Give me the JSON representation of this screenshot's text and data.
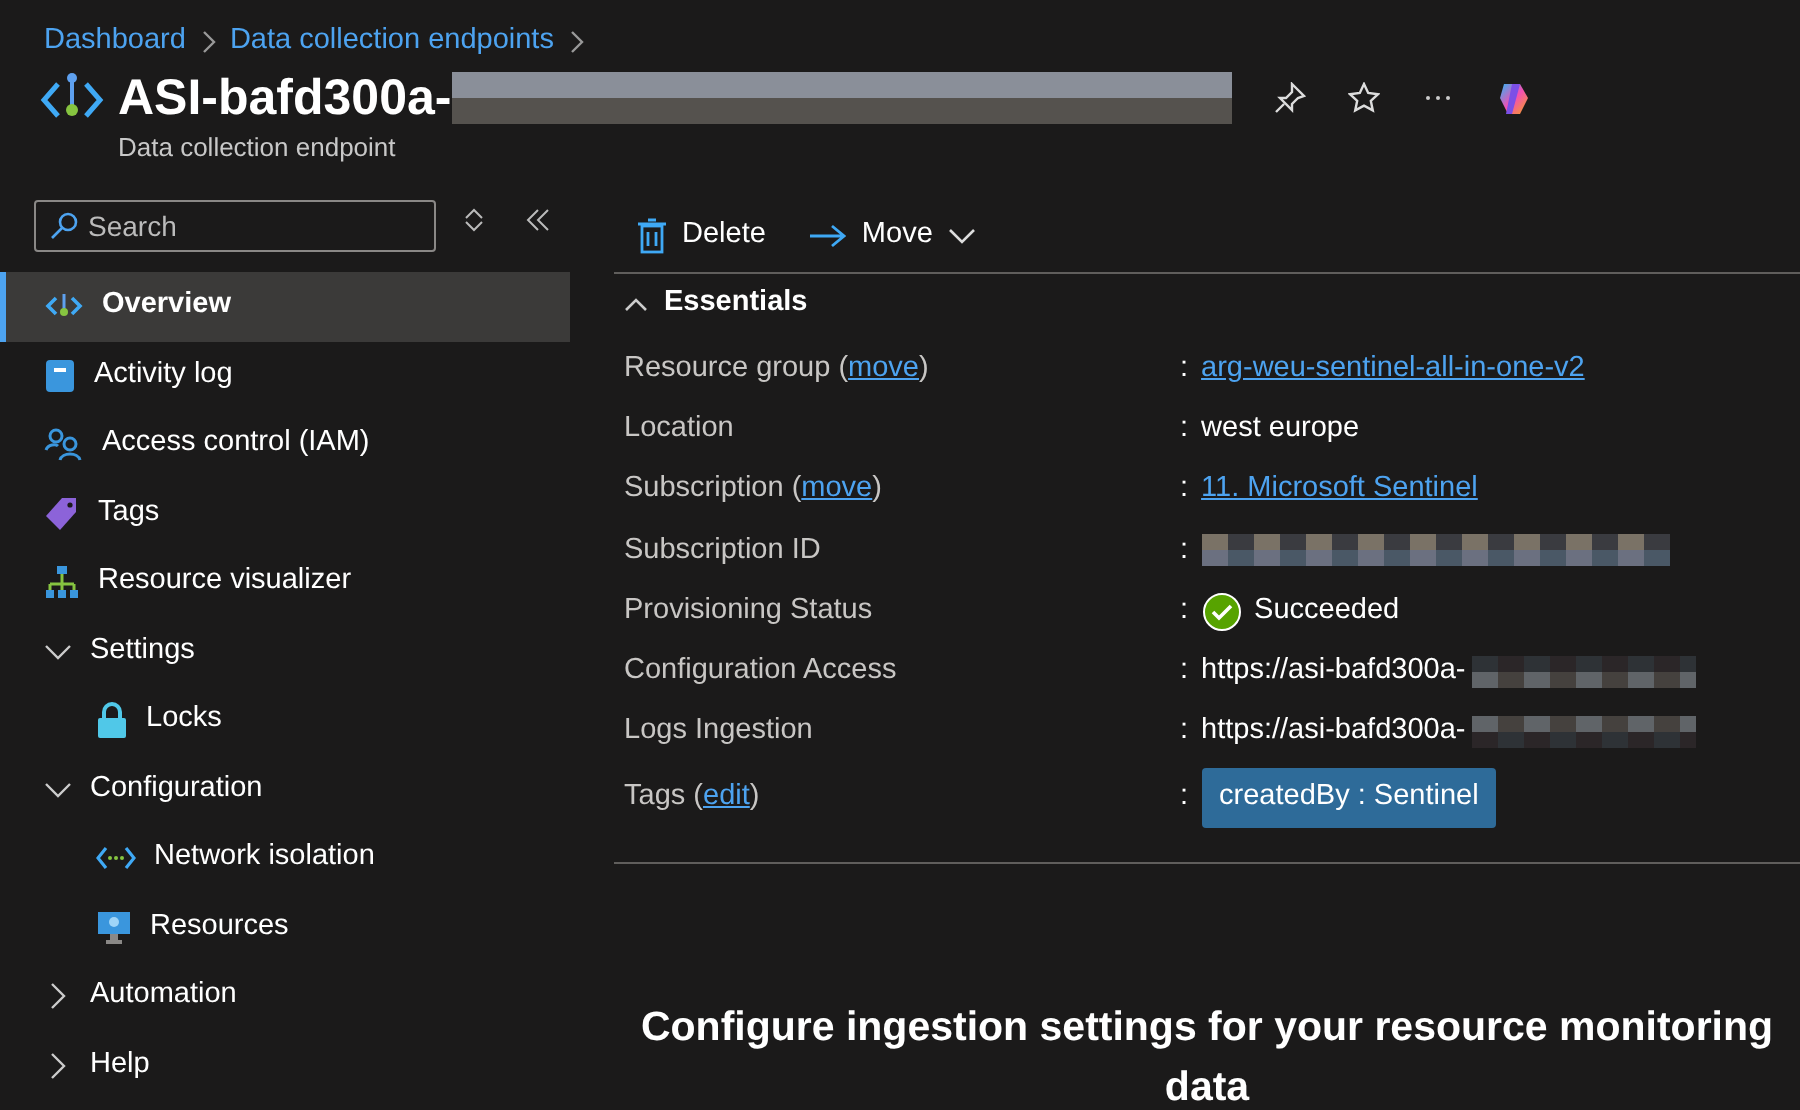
{
  "breadcrumb": [
    "Dashboard",
    "Data collection endpoints"
  ],
  "header": {
    "title": "ASI-bafd300a-",
    "subtitle": "Data collection endpoint"
  },
  "search": {
    "placeholder": "Search"
  },
  "sidebar": {
    "items": [
      {
        "kind": "item",
        "label": "Overview",
        "selected": true
      },
      {
        "kind": "item",
        "label": "Activity log",
        "selected": false
      },
      {
        "kind": "item",
        "label": "Access control (IAM)",
        "selected": false
      },
      {
        "kind": "item",
        "label": "Tags",
        "selected": false
      },
      {
        "kind": "item",
        "label": "Resource visualizer",
        "selected": false
      },
      {
        "kind": "group",
        "label": "Settings",
        "expanded": true,
        "children": [
          {
            "kind": "item",
            "label": "Locks",
            "selected": false
          }
        ]
      },
      {
        "kind": "group",
        "label": "Configuration",
        "expanded": true,
        "children": [
          {
            "kind": "item",
            "label": "Network isolation",
            "selected": false
          },
          {
            "kind": "item",
            "label": "Resources",
            "selected": false
          }
        ]
      },
      {
        "kind": "group",
        "label": "Automation",
        "expanded": false
      },
      {
        "kind": "group",
        "label": "Help",
        "expanded": false
      }
    ]
  },
  "toolbar": [
    {
      "kind": "delete",
      "label": "Delete"
    },
    {
      "kind": "move",
      "label": "Move"
    }
  ],
  "essentials": {
    "title": "Essentials",
    "expanded": true,
    "rows": [
      {
        "label": "Resource group (",
        "link": "move",
        "label_end": ")",
        "separator": ":",
        "kind": "link",
        "value": "arg-weu-sentinel-all-in-one-v2"
      },
      {
        "label": "Location",
        "separator": ":",
        "kind": "text",
        "value": "west europe"
      },
      {
        "label": "Subscription (",
        "link": "move",
        "label_end": ")",
        "separator": ":",
        "kind": "link",
        "value": "11. Microsoft Sentinel"
      },
      {
        "label": "Subscription ID",
        "separator": ":",
        "kind": "redacted"
      },
      {
        "label": "Provisioning Status",
        "separator": ":",
        "kind": "status",
        "value": "Succeeded"
      },
      {
        "label": "Configuration Access",
        "separator": ":",
        "kind": "url",
        "value": "https://asi-bafd300a-"
      },
      {
        "label": "Logs Ingestion",
        "separator": ":",
        "kind": "url",
        "value": "https://asi-bafd300a-"
      },
      {
        "label": "Tags (",
        "link": "edit",
        "label_end": ")",
        "separator": ":",
        "kind": "tag",
        "value": "createdBy : Sentinel"
      }
    ]
  },
  "heading": "Configure ingestion settings for your resource monitoring data"
}
